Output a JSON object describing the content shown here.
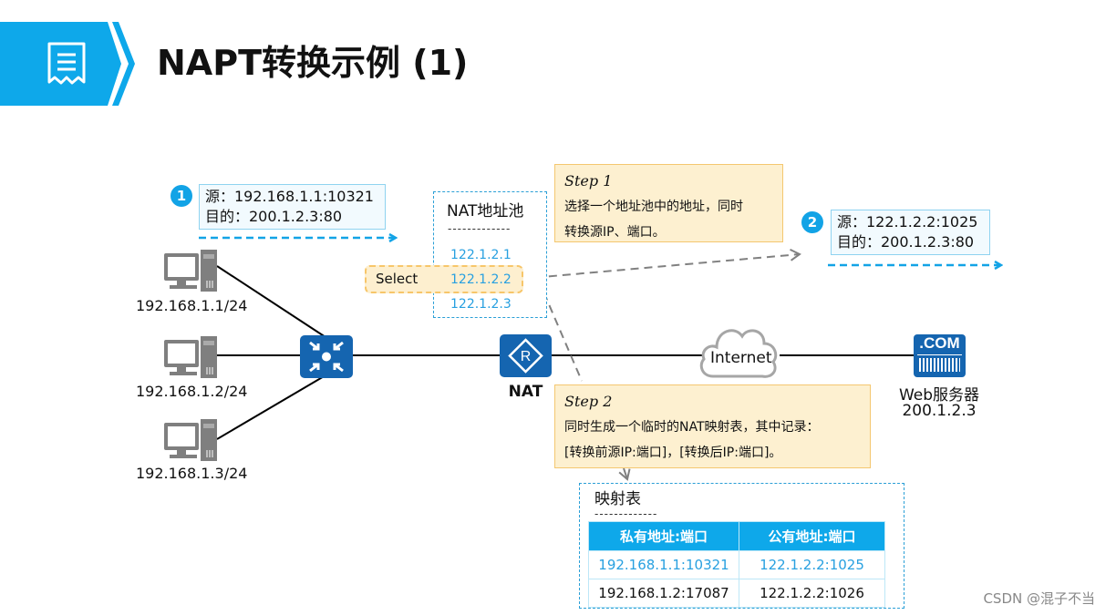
{
  "header": {
    "icon": "document-icon",
    "title": "NAPT转换示例 (1)"
  },
  "colors": {
    "accent_blue": "#0ea8ea",
    "device_blue": "#1565b0",
    "step_bg": "#fdf0d0",
    "step_border": "#f4c770",
    "ip_blue": "#28a0e0"
  },
  "packet1": {
    "badge": "1",
    "src": "源：192.168.1.1:10321",
    "dst": "目的：200.1.2.3:80"
  },
  "packet2": {
    "badge": "2",
    "src": "源：122.1.2.2:1025",
    "dst": "目的：200.1.2.3:80"
  },
  "hosts": [
    {
      "label": "192.168.1.1/24",
      "icon": "pc-icon"
    },
    {
      "label": "192.168.1.2/24",
      "icon": "pc-icon"
    },
    {
      "label": "192.168.1.3/24",
      "icon": "pc-icon"
    }
  ],
  "switch": {
    "icon": "switch-icon"
  },
  "nat_router": {
    "label": "NAT",
    "icon": "router-icon"
  },
  "internet": {
    "label": "Internet",
    "icon": "cloud-icon"
  },
  "server": {
    "badge_text": ".COM",
    "name": "Web服务器",
    "ip": "200.1.2.3",
    "icon": "web-server-icon"
  },
  "pool": {
    "title": "NAT地址池",
    "separator": "-------------",
    "addresses": [
      "122.1.2.1",
      "122.1.2.2",
      "122.1.2.3"
    ],
    "select_label": "Select"
  },
  "step1": {
    "title": "Step 1",
    "line1": "选择一个地址池中的地址，同时",
    "line2": "转换源IP、端口。"
  },
  "step2": {
    "title": "Step 2",
    "line1": "同时生成一个临时的NAT映射表，其中记录：",
    "line2": "[转换前源IP:端口]，[转换后IP:端口]。"
  },
  "mapping_table": {
    "title": "映射表",
    "separator": "-------------",
    "columns": [
      "私有地址:端口",
      "公有地址:端口"
    ],
    "rows": [
      [
        "192.168.1.1:10321",
        "122.1.2.2:1025"
      ],
      [
        "192.168.1.2:17087",
        "122.1.2.2:1026"
      ]
    ]
  },
  "watermark": "CSDN @混子不当"
}
